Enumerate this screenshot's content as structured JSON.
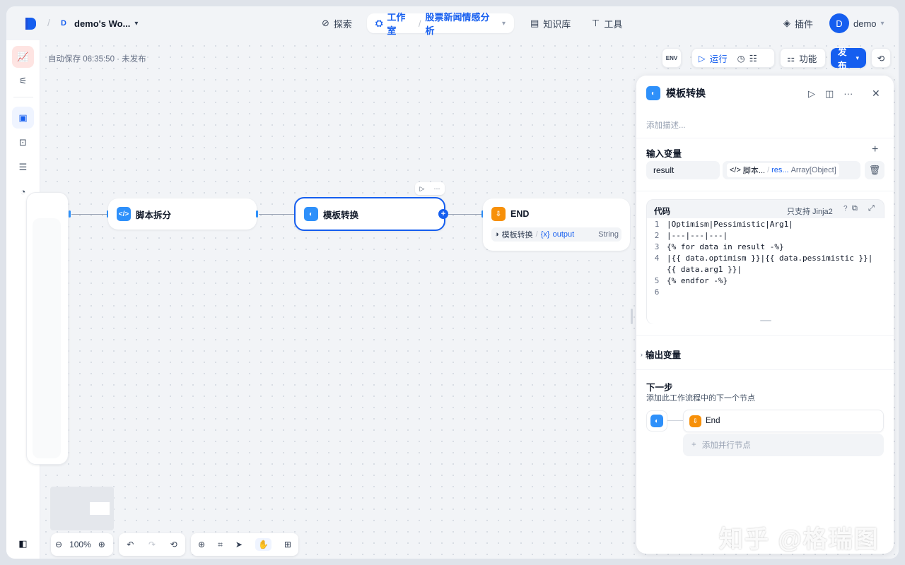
{
  "topbar": {
    "workspace_badge": "D",
    "workspace_name": "demo's Wo...",
    "nav_explore": "探索",
    "nav_studio": "工作室",
    "nav_app": "股票新闻情感分析",
    "nav_knowledge": "知识库",
    "nav_tools": "工具",
    "plugins": "插件",
    "user_initial": "D",
    "user_name": "demo"
  },
  "toolbar": {
    "autosave": "自动保存 06:35:50 · 未发布",
    "env": "ENV",
    "run": "运行",
    "features": "功能",
    "publish": "发布"
  },
  "nodes": {
    "script_split": "脚本拆分",
    "template": "模板转换",
    "end": "END",
    "end_var_source": "模板转换",
    "end_var_name": "output",
    "end_var_type": "String"
  },
  "panel": {
    "title": "模板转换",
    "description_placeholder": "添加描述...",
    "input_vars_label": "输入变量",
    "var_name": "result",
    "var_source": "脚本...",
    "var_field": "res...",
    "var_type": "Array[Object]",
    "code_label": "代码",
    "jinja_note": "只支持 Jinja2",
    "code_lines": [
      {
        "n": "1",
        "t": "|Optimism|Pessimistic|Arg1|"
      },
      {
        "n": "2",
        "t": "|---|---|---|"
      },
      {
        "n": "3",
        "t": "{% for data in result -%}"
      },
      {
        "n": "4",
        "t": "|{{ data.optimism }}|{{ data.pessimistic }}|"
      },
      {
        "n": "",
        "t": "{{ data.arg1 }}|"
      },
      {
        "n": "5",
        "t": "{% endfor -%}"
      },
      {
        "n": "6",
        "t": ""
      }
    ],
    "output_vars_label": "输出变量",
    "next_step_label": "下一步",
    "next_step_desc": "添加此工作流程中的下一个节点",
    "next_node": "End",
    "add_parallel": "添加并行节点"
  },
  "canvas_controls": {
    "zoom": "100%"
  },
  "watermark": "知乎 @格瑞图",
  "colors": {
    "accent": "#155eef",
    "node_blue": "#2e90fa",
    "node_orange": "#f79009"
  }
}
